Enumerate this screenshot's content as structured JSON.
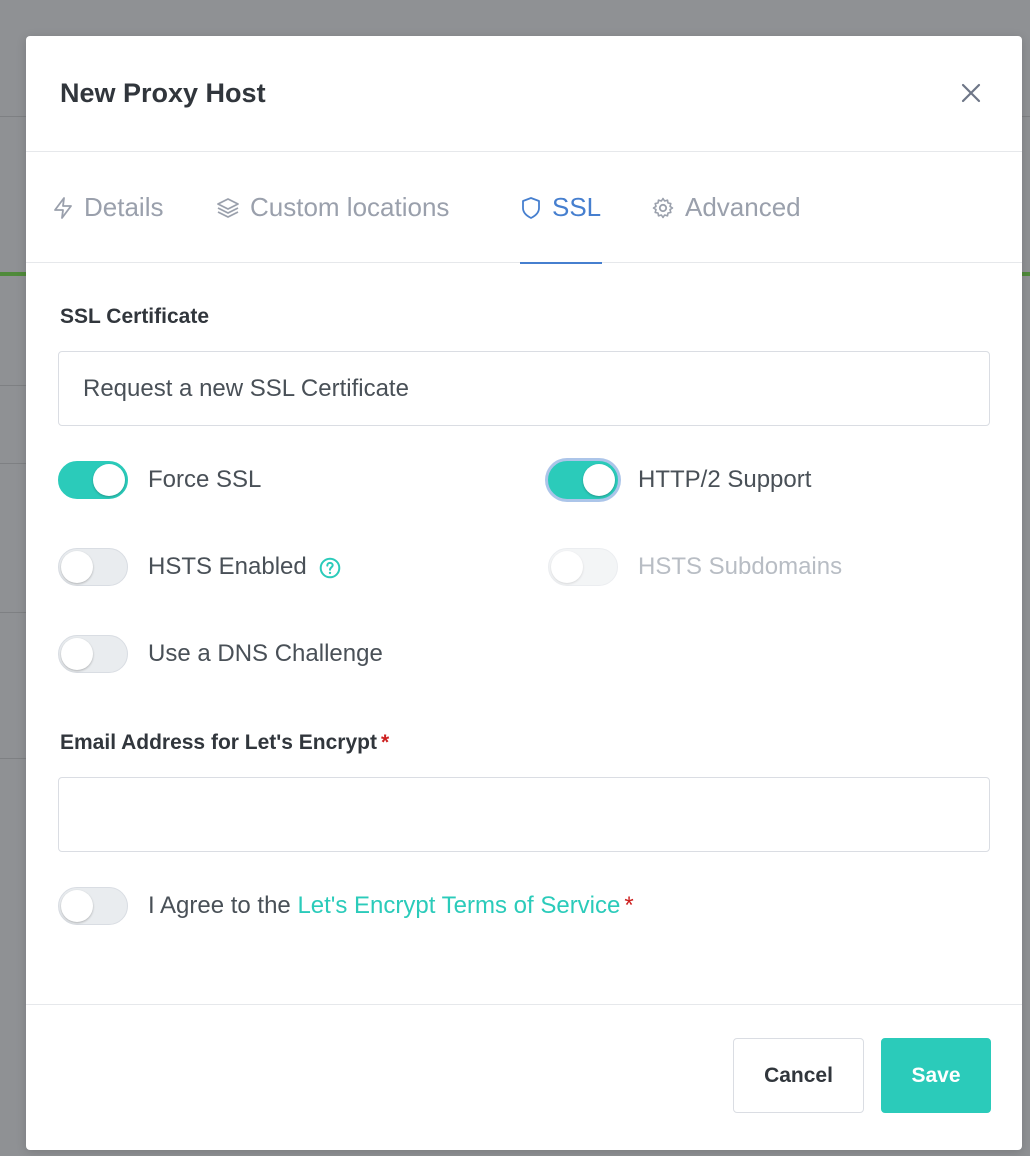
{
  "modal": {
    "title": "New Proxy Host",
    "tabs": [
      {
        "label": "Details",
        "icon": "lightning-icon",
        "active": false
      },
      {
        "label": "Custom locations",
        "icon": "layers-icon",
        "active": false
      },
      {
        "label": "SSL",
        "icon": "shield-icon",
        "active": true
      },
      {
        "label": "Advanced",
        "icon": "gear-icon",
        "active": false
      }
    ],
    "ssl": {
      "certificate_label": "SSL Certificate",
      "certificate_value": "Request a new SSL Certificate",
      "toggles": {
        "force_ssl": {
          "label": "Force SSL",
          "on": true
        },
        "http2": {
          "label": "HTTP/2 Support",
          "on": true
        },
        "hsts": {
          "label": "HSTS Enabled",
          "on": false
        },
        "hsts_subdomains": {
          "label": "HSTS Subdomains",
          "on": false,
          "disabled": true
        },
        "dns_challenge": {
          "label": "Use a DNS Challenge",
          "on": false
        }
      },
      "email_label": "Email Address for Let's Encrypt",
      "required_mark": "*",
      "email_value": "",
      "agree_prefix": "I Agree to the ",
      "agree_link": "Let's Encrypt Terms of Service",
      "agree_on": false
    },
    "footer": {
      "cancel_label": "Cancel",
      "save_label": "Save"
    }
  },
  "colors": {
    "accent_teal": "#2bcbba",
    "tab_active_blue": "#467fcf",
    "required_red": "#cd201f"
  }
}
